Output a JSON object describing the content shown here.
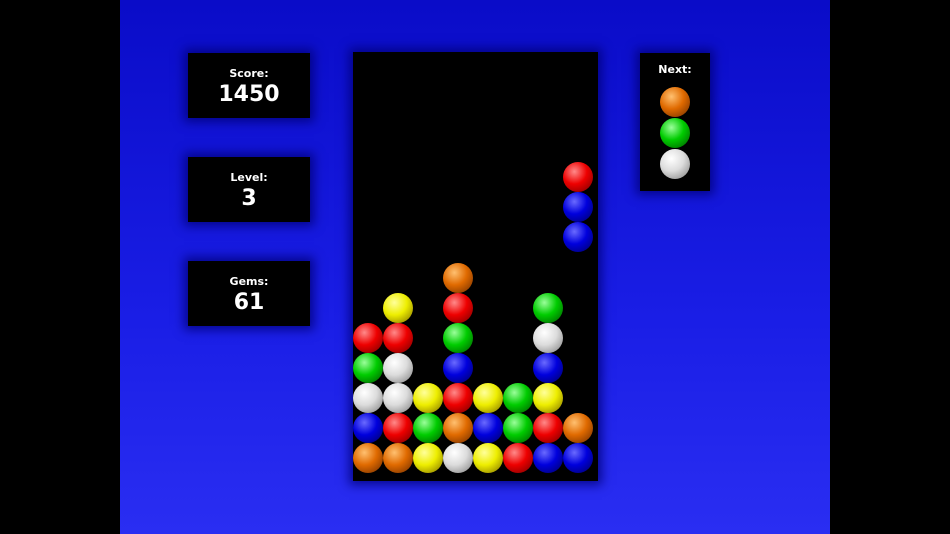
{
  "score": {
    "label": "Score:",
    "value": "1450"
  },
  "level": {
    "label": "Level:",
    "value": "3"
  },
  "gems": {
    "label": "Gems:",
    "value": "61"
  },
  "next": {
    "label": "Next:",
    "pieces": [
      "orange",
      "green",
      "white"
    ]
  },
  "colors": {
    "red": [
      "#ff8a8a",
      "#ee0000",
      "#700000"
    ],
    "blue": [
      "#6a6aff",
      "#0000dd",
      "#000060"
    ],
    "green": [
      "#9aff9a",
      "#00cc00",
      "#005500"
    ],
    "yellow": [
      "#ffff9a",
      "#eeee00",
      "#7a6a00"
    ],
    "orange": [
      "#ffc070",
      "#e06a00",
      "#6a2a00"
    ],
    "white": [
      "#ffffff",
      "#dcdcdc",
      "#7a7a7a"
    ]
  },
  "board": {
    "columns": 8,
    "falling": {
      "col": 7,
      "top_row": 4,
      "gems": [
        "red",
        "blue",
        "blue"
      ]
    },
    "stack": [
      {
        "row": 7,
        "gems": [
          null,
          null,
          null,
          "orange",
          null,
          null,
          null,
          null
        ]
      },
      {
        "row": 8,
        "gems": [
          null,
          "yellow",
          null,
          "red",
          null,
          null,
          "green",
          null
        ]
      },
      {
        "row": 9,
        "gems": [
          "red",
          "red",
          null,
          "green",
          null,
          null,
          "white",
          null
        ]
      },
      {
        "row": 10,
        "gems": [
          "green",
          "white",
          null,
          "blue",
          null,
          null,
          "blue",
          null
        ]
      },
      {
        "row": 11,
        "gems": [
          "white",
          "white",
          "yellow",
          "red",
          "yellow",
          "green",
          "yellow",
          null
        ]
      },
      {
        "row": 12,
        "gems": [
          "blue",
          "red",
          "green",
          "orange",
          "blue",
          "green",
          "red",
          "orange"
        ]
      },
      {
        "row": 13,
        "gems": [
          "orange",
          "orange",
          "yellow",
          "white",
          "yellow",
          "red",
          "blue",
          "blue"
        ]
      }
    ]
  }
}
